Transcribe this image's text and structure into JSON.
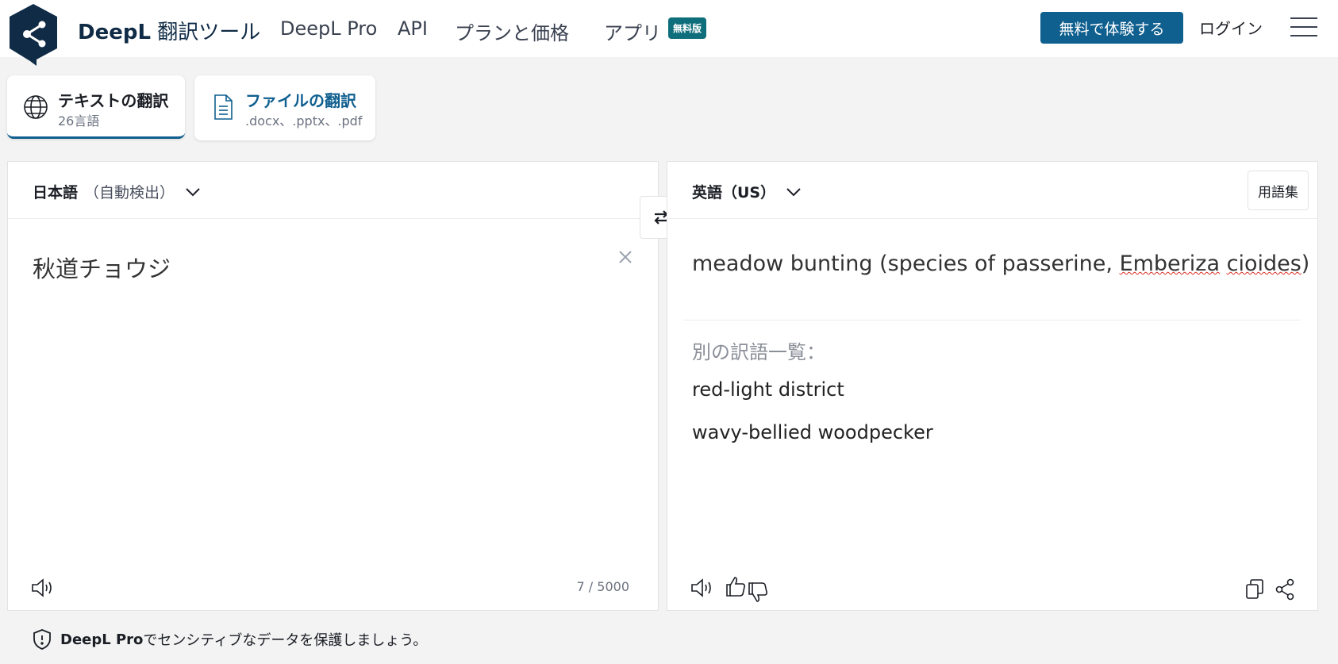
{
  "header": {
    "brand_name": "DeepL",
    "brand_suffix": "翻訳ツール",
    "nav": [
      "DeepL Pro",
      "API",
      "プランと価格",
      "アプリ"
    ],
    "badge": "無料版",
    "cta": "無料で体験する",
    "login": "ログイン"
  },
  "tabs": {
    "text": {
      "title": "テキストの翻訳",
      "subtitle": "26言語"
    },
    "file": {
      "title": "ファイルの翻訳",
      "subtitle": ".docx、.pptx、.pdf"
    }
  },
  "source": {
    "lang": "日本語",
    "detect": "（自動検出）",
    "text": "秋道チョウジ",
    "char_count": "7 / 5000"
  },
  "target": {
    "lang": "英語（US）",
    "glossary": "用語集",
    "text_pre": "meadow bunting (species of passerine, ",
    "text_word1": "Emberiza",
    "text_space": " ",
    "text_word2": "cioides",
    "text_post": ")",
    "alt_label": "別の訳語一覧：",
    "alternatives": [
      "red-light district",
      "wavy-bellied woodpecker"
    ]
  },
  "notice": {
    "brand": "DeepL Pro",
    "text": "でセンシティブなデータを保護しましょう。"
  },
  "colors": {
    "brand_navy": "#0f2b46",
    "accent_blue": "#0f5f8f",
    "badge_teal": "#0f6e7b",
    "spell_red": "#d93025"
  }
}
